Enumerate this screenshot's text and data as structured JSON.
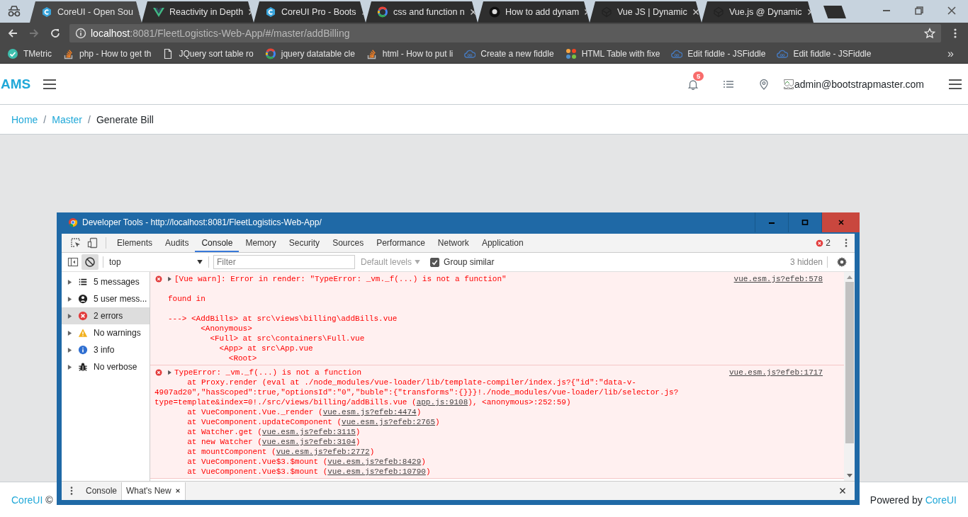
{
  "browser": {
    "tabs": [
      {
        "title": "CoreUI - Open Sou",
        "kind": "coreui",
        "selected": true
      },
      {
        "title": "Reactivity in Depth",
        "kind": "vue",
        "selected": false
      },
      {
        "title": "CoreUI Pro - Boots",
        "kind": "coreui",
        "selected": false
      },
      {
        "title": "css and function n",
        "kind": "google",
        "selected": false
      },
      {
        "title": "How to add dynam",
        "kind": "github",
        "selected": false
      },
      {
        "title": "Vue JS | Dynamic",
        "kind": "codepen",
        "selected": false
      },
      {
        "title": "Vue.js @ Dynamic",
        "kind": "codepen",
        "selected": false
      }
    ],
    "address": {
      "host": "localhost",
      "path": ":8081/FleetLogistics-Web-App/#/master/addBilling"
    },
    "bookmarks": [
      {
        "label": "TMetric",
        "kind": "tmetric"
      },
      {
        "label": "php - How to get th",
        "kind": "stackoverflow"
      },
      {
        "label": "JQuery sort table ro",
        "kind": "page"
      },
      {
        "label": "jquery datatable cle",
        "kind": "google"
      },
      {
        "label": "html - How to put li",
        "kind": "stackoverflow"
      },
      {
        "label": "Create a new fiddle",
        "kind": "jsfiddle"
      },
      {
        "label": "HTML Table with fixe",
        "kind": "joomla"
      },
      {
        "label": "Edit fiddle - JSFiddle",
        "kind": "jsfiddle"
      },
      {
        "label": "Edit fiddle - JSFiddle",
        "kind": "jsfiddle"
      }
    ],
    "overflow": "»"
  },
  "app": {
    "brand": "AMS",
    "notification_count": "5",
    "user": "admin@bootstrapmaster.com",
    "separator": "/",
    "breadcrumb": [
      {
        "label": "Home",
        "current": false
      },
      {
        "label": "Master",
        "current": false
      },
      {
        "label": "Generate Bill",
        "current": true
      }
    ]
  },
  "footer": {
    "left_link": "CoreUI",
    "left_text": "©",
    "right_text": "Powered by",
    "right_link": "CoreUI"
  },
  "devtools": {
    "title": "Developer Tools - http://localhost:8081/FleetLogistics-Web-App/",
    "tabs": [
      {
        "label": "Elements",
        "selected": false
      },
      {
        "label": "Audits",
        "selected": false
      },
      {
        "label": "Console",
        "selected": true
      },
      {
        "label": "Memory",
        "selected": false
      },
      {
        "label": "Security",
        "selected": false
      },
      {
        "label": "Sources",
        "selected": false
      },
      {
        "label": "Performance",
        "selected": false
      },
      {
        "label": "Network",
        "selected": false
      },
      {
        "label": "Application",
        "selected": false
      }
    ],
    "error_count": "2",
    "context": "top",
    "filter": {
      "placeholder": "Filter"
    },
    "levels": {
      "label": "Default levels",
      "disabled": true
    },
    "group_similar": {
      "label": "Group similar",
      "checked": true
    },
    "hidden_count": "3 hidden",
    "sidebar": [
      {
        "label": "5 messages",
        "kind": "list",
        "selected": false
      },
      {
        "label": "5 user mess...",
        "kind": "user",
        "selected": false
      },
      {
        "label": "2 errors",
        "kind": "error",
        "selected": true
      },
      {
        "label": "No warnings",
        "kind": "warning",
        "selected": false
      },
      {
        "label": "3 info",
        "kind": "info",
        "selected": false
      },
      {
        "label": "No verbose",
        "kind": "bug",
        "selected": false
      }
    ],
    "messages": [
      {
        "kind": "vue_warn",
        "expanded": false,
        "text": "[Vue warn]: Error in render: \"TypeError: _vm._f(...) is not a function\"",
        "source": "vue.esm.js?efeb:578",
        "body": [
          {
            "parts": [
              {
                "text": "found in",
                "kind": "text"
              }
            ]
          },
          {
            "parts": [
              {
                "text": "---> <AddBills> at src\\views\\billing\\addBills.vue\n       <Anonymous>\n         <Full> at src\\containers\\Full.vue\n           <App> at src\\App.vue\n             <Root>",
                "kind": "text"
              }
            ]
          }
        ]
      },
      {
        "kind": "exception",
        "expanded": false,
        "text": "TypeError: _vm._f(...) is not a function",
        "source": "vue.esm.js?efeb:1717",
        "body": [
          {
            "parts": [
              {
                "text": "       at Proxy.render (eval at ./node_modules/vue-loader/lib/template-compiler/index.js?{\"id\":\"data-v-",
                "kind": "text"
              }
            ]
          },
          {
            "parts": [
              {
                "text": "4907ad20\",\"hasScoped\":true,\"optionsId\":\"0\",\"buble\":{\"transforms\":{}}}!./node_modules/vue-loader/lib/selector.js?",
                "kind": "text"
              }
            ]
          },
          {
            "parts": [
              {
                "text": "type=template&index=0!./src/views/billing/addBills.vue (",
                "kind": "text"
              },
              {
                "text": "app.js:9108",
                "kind": "link"
              },
              {
                "text": "), <anonymous>:252:59)",
                "kind": "text"
              }
            ]
          },
          {
            "parts": [
              {
                "text": "       at VueComponent.Vue._render (",
                "kind": "text"
              },
              {
                "text": "vue.esm.js?efeb:4474",
                "kind": "link"
              },
              {
                "text": ")",
                "kind": "text"
              }
            ]
          },
          {
            "parts": [
              {
                "text": "       at VueComponent.updateComponent (",
                "kind": "text"
              },
              {
                "text": "vue.esm.js?efeb:2765",
                "kind": "link"
              },
              {
                "text": ")",
                "kind": "text"
              }
            ]
          },
          {
            "parts": [
              {
                "text": "       at Watcher.get (",
                "kind": "text"
              },
              {
                "text": "vue.esm.js?efeb:3115",
                "kind": "link"
              },
              {
                "text": ")",
                "kind": "text"
              }
            ]
          },
          {
            "parts": [
              {
                "text": "       at new Watcher (",
                "kind": "text"
              },
              {
                "text": "vue.esm.js?efeb:3104",
                "kind": "link"
              },
              {
                "text": ")",
                "kind": "text"
              }
            ]
          },
          {
            "parts": [
              {
                "text": "       at mountComponent (",
                "kind": "text"
              },
              {
                "text": "vue.esm.js?efeb:2772",
                "kind": "link"
              },
              {
                "text": ")",
                "kind": "text"
              }
            ]
          },
          {
            "parts": [
              {
                "text": "       at VueComponent.Vue$3.$mount (",
                "kind": "text"
              },
              {
                "text": "vue.esm.js?efeb:8429",
                "kind": "link"
              },
              {
                "text": ")",
                "kind": "text"
              }
            ]
          },
          {
            "parts": [
              {
                "text": "       at VueComponent.Vue$3.$mount (",
                "kind": "text"
              },
              {
                "text": "vue.esm.js?efeb:10790",
                "kind": "link"
              },
              {
                "text": ")",
                "kind": "text"
              }
            ]
          }
        ]
      }
    ],
    "drawer": [
      {
        "label": "Console",
        "selected": false
      },
      {
        "label": "What's New",
        "selected": true
      }
    ]
  }
}
